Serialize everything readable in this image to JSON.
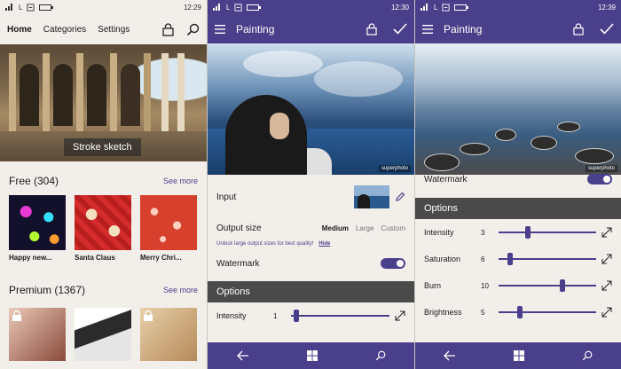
{
  "screen1": {
    "status": {
      "signal": "L",
      "time": "12:29"
    },
    "nav": {
      "tabs": [
        "Home",
        "Categories",
        "Settings"
      ],
      "active": "Home"
    },
    "hero": {
      "caption": "Stroke sketch"
    },
    "free": {
      "title": "Free (304)",
      "more": "See more",
      "items": [
        {
          "label": "Happy new..."
        },
        {
          "label": "Santa Claus"
        },
        {
          "label": "Merry Chri..."
        }
      ]
    },
    "premium": {
      "title": "Premium (1367)",
      "more": "See more"
    }
  },
  "screen2": {
    "status": {
      "signal": "L",
      "time": "12:30"
    },
    "appbar": {
      "title": "Painting"
    },
    "watermark_text": "superphoto",
    "input": {
      "label": "Input"
    },
    "output_size": {
      "label": "Output size",
      "options": [
        "Medium",
        "Large",
        "Custom"
      ],
      "selected": "Medium",
      "hint": "Unlock large output sizes for best quality!",
      "hint_link": "Hide"
    },
    "watermark": {
      "label": "Watermark",
      "on": true
    },
    "options": {
      "title": "Options",
      "sliders": [
        {
          "name": "Intensity",
          "value": "1",
          "fraction": 0.05
        }
      ]
    }
  },
  "screen3": {
    "status": {
      "signal": "L",
      "time": "12:39"
    },
    "appbar": {
      "title": "Painting"
    },
    "watermark_text": "superphoto",
    "watermark": {
      "label": "Watermark",
      "on": true
    },
    "options": {
      "title": "Options",
      "sliders": [
        {
          "name": "Intensity",
          "value": "3",
          "fraction": 0.3
        },
        {
          "name": "Saturation",
          "value": "6",
          "fraction": 0.12
        },
        {
          "name": "Burn",
          "value": "10",
          "fraction": 0.65
        },
        {
          "name": "Brightness",
          "value": "5",
          "fraction": 0.22
        }
      ]
    }
  },
  "colors": {
    "accent": "#4a3f8a",
    "background": "#f2efea",
    "options_header": "#4a4a4a"
  }
}
